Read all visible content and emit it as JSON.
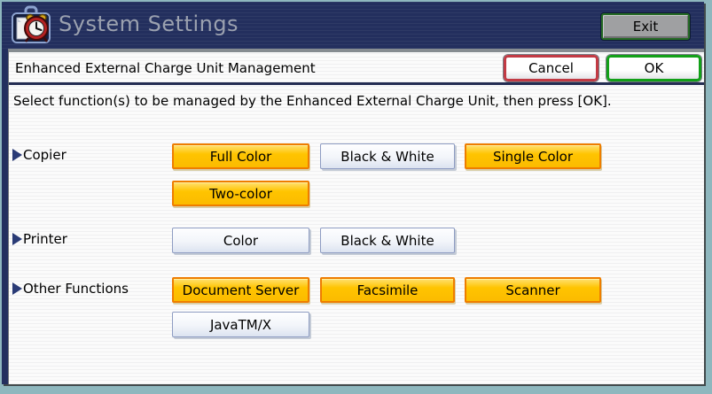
{
  "titlebar": {
    "title": "System Settings",
    "exit_label": "Exit"
  },
  "header": {
    "title": "Enhanced External Charge Unit Management",
    "cancel_label": "Cancel",
    "ok_label": "OK"
  },
  "instruction": "Select function(s) to be managed by the Enhanced External Charge Unit, then press [OK].",
  "groups": [
    {
      "label": "Copier",
      "buttons": [
        {
          "label": "Full Color",
          "selected": true
        },
        {
          "label": "Black & White",
          "selected": false
        },
        {
          "label": "Single Color",
          "selected": true
        },
        {
          "label": "Two-color",
          "selected": true
        }
      ]
    },
    {
      "label": "Printer",
      "buttons": [
        {
          "label": "Color",
          "selected": false
        },
        {
          "label": "Black & White",
          "selected": false
        }
      ]
    },
    {
      "label": "Other Functions",
      "buttons": [
        {
          "label": "Document Server",
          "selected": true
        },
        {
          "label": "Facsimile",
          "selected": true
        },
        {
          "label": "Scanner",
          "selected": true
        },
        {
          "label": "JavaTM/X",
          "selected": false
        }
      ]
    }
  ],
  "icons": {
    "app_icon": "alarm-clock-toolbox-icon",
    "group_marker": "right-triangle-icon"
  },
  "colors": {
    "frame": "#8EB7BE",
    "titlebar_bg": "#232F5E",
    "titlebar_text": "#9BA1AF",
    "selected_bg": "#FFC400",
    "selected_border": "#EE7D00",
    "unselected_bg": "#F2F5FA",
    "unselected_border": "#8E9CC2",
    "cancel_border": "#C23A44",
    "ok_border": "#12A018",
    "exit_border": "#256B25",
    "exit_bg": "#9FA0A2"
  }
}
